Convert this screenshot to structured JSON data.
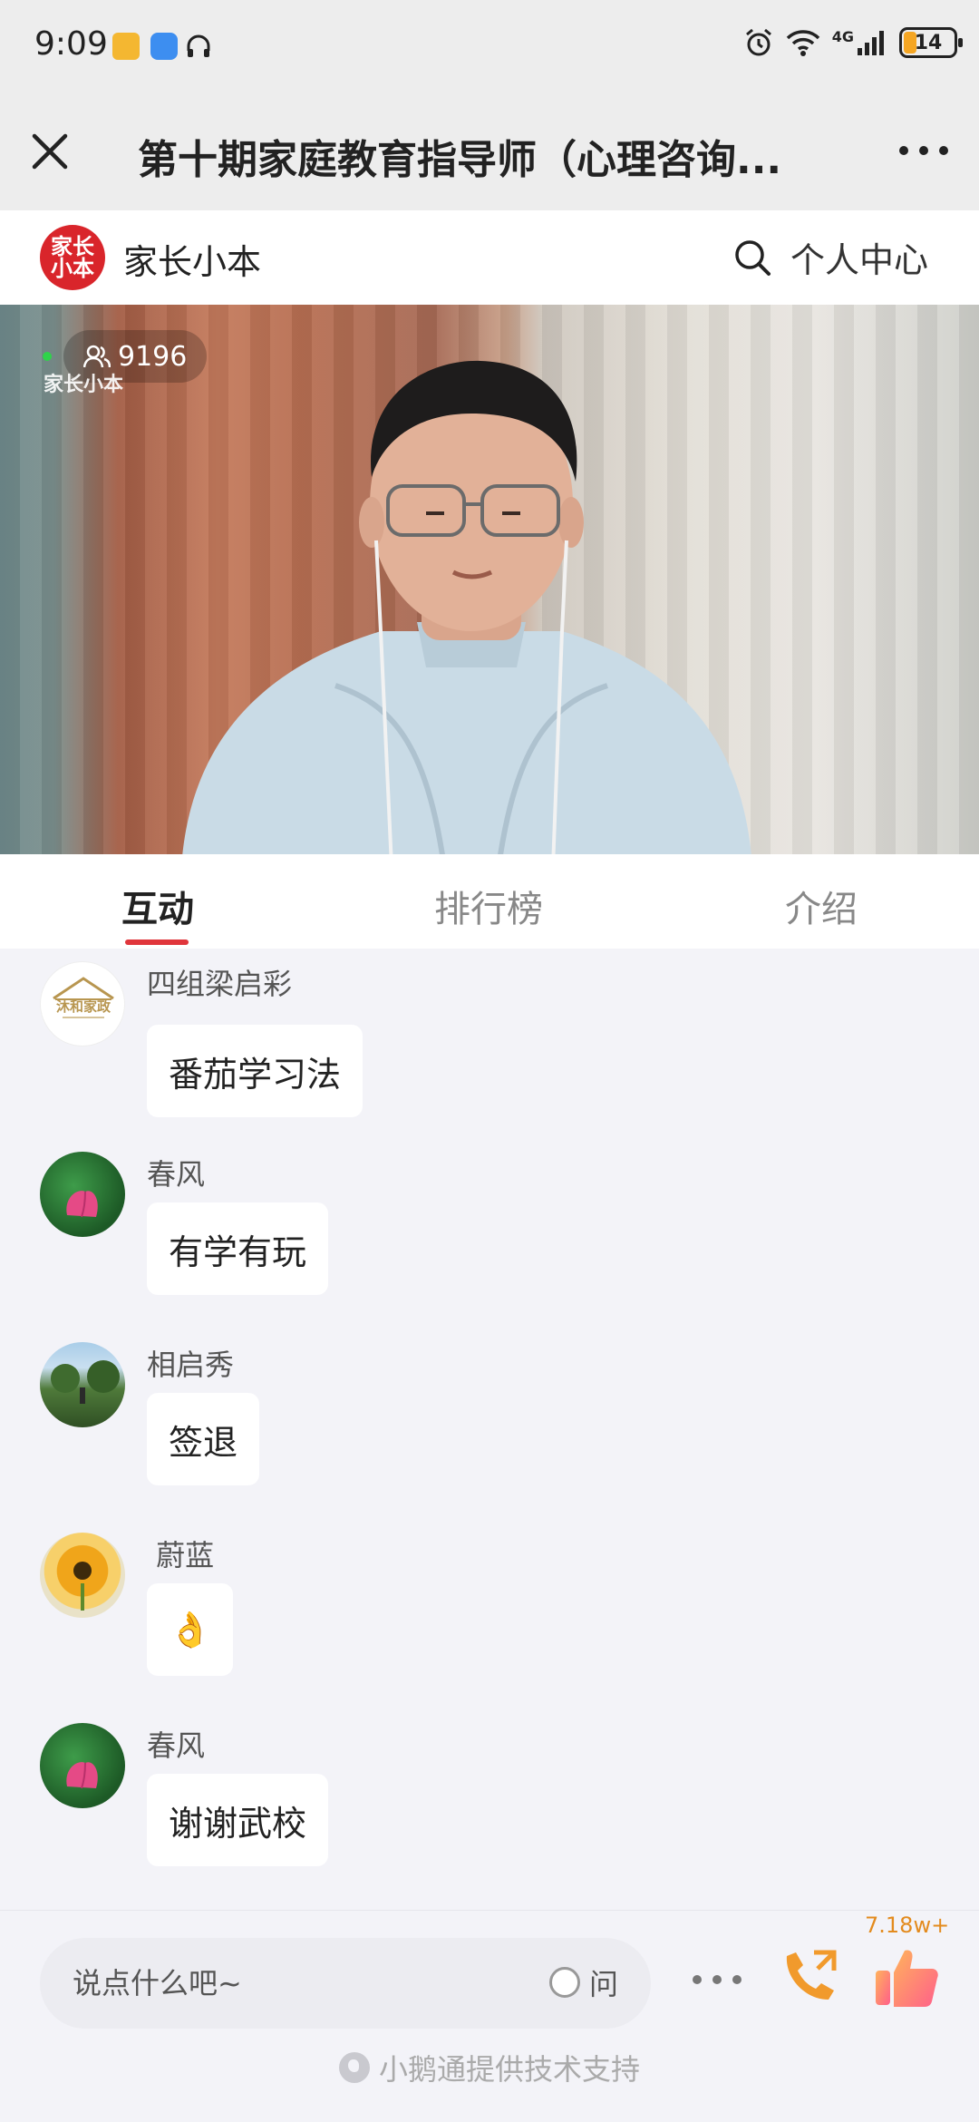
{
  "status_bar": {
    "time": "9:09",
    "network": "4G",
    "battery": "14"
  },
  "title_bar": {
    "title": "第十期家庭教育指导师（心理咨询..."
  },
  "brand_bar": {
    "logo_text_line1": "家长",
    "logo_text_line2": "小本",
    "brand_name": "家长小本",
    "personal_center": "个人中心"
  },
  "video": {
    "viewer_count": "9196",
    "watermark": "家长小本"
  },
  "tabs": [
    {
      "label": "互动",
      "active": true
    },
    {
      "label": "排行榜",
      "active": false
    },
    {
      "label": "介绍",
      "active": false
    }
  ],
  "messages": [
    {
      "sender": "四组梁启彩",
      "text": "番茄学习法",
      "avatar": "house-logo-avatar"
    },
    {
      "sender": "春风",
      "text": "有学有玩",
      "avatar": "lotus-avatar"
    },
    {
      "sender": "相启秀",
      "text": "签退",
      "avatar": "landscape-avatar"
    },
    {
      "sender": " 蔚蓝",
      "text": "👌",
      "avatar": "sunflower-avatar"
    },
    {
      "sender": "春风",
      "text": "谢谢武校",
      "avatar": "lotus-avatar"
    }
  ],
  "avatar_badge_text": "沐和家政",
  "bottom_bar": {
    "input_placeholder": "说点什么吧~",
    "ask_label": "问",
    "like_count": "7.18w+",
    "footer": "小鹅通提供技术支持"
  },
  "colors": {
    "accent": "#e0363c",
    "logo_red": "#d9252b",
    "like_orange": "#e38b1e"
  }
}
